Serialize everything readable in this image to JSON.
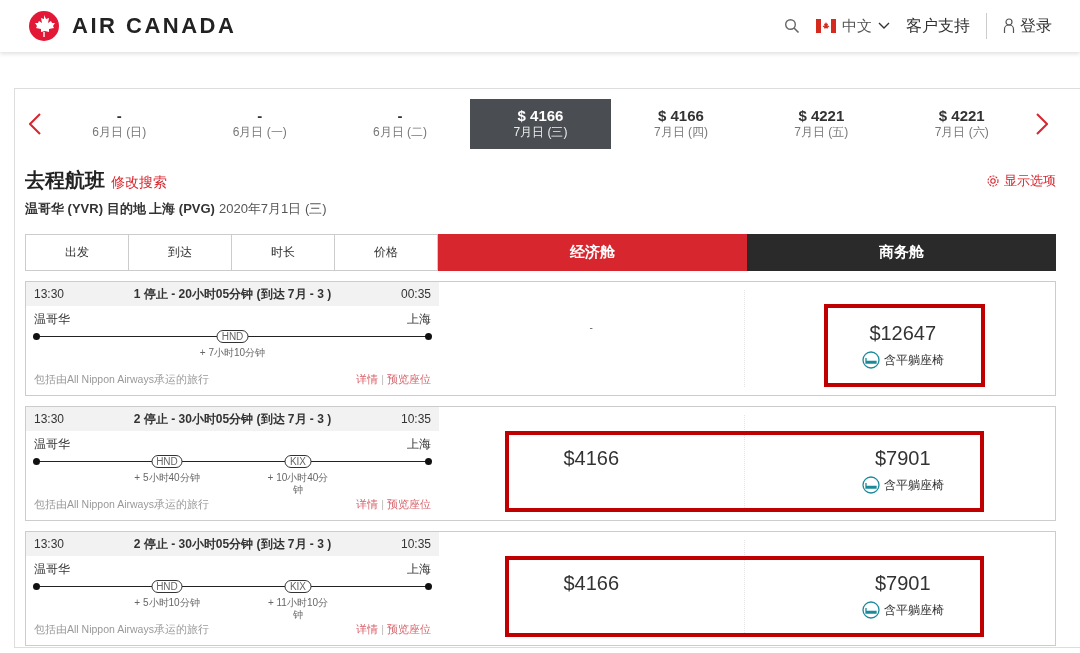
{
  "header": {
    "brand": "AIR CANADA",
    "language": "中文",
    "support": "客户支持",
    "login": "登录"
  },
  "dates": [
    {
      "price": "-",
      "date": "6月日 (日)",
      "selected": false
    },
    {
      "price": "-",
      "date": "6月日 (一)",
      "selected": false
    },
    {
      "price": "-",
      "date": "6月日 (二)",
      "selected": false
    },
    {
      "price": "$ 4166",
      "date": "7月日 (三)",
      "selected": true
    },
    {
      "price": "$ 4166",
      "date": "7月日 (四)",
      "selected": false
    },
    {
      "price": "$ 4221",
      "date": "7月日 (五)",
      "selected": false
    },
    {
      "price": "$ 4221",
      "date": "7月日 (六)",
      "selected": false
    }
  ],
  "heading": {
    "title": "去程航班",
    "modify": "修改搜索",
    "options": "显示选项",
    "route": "温哥华 (YVR) 目的地 上海 (PVG)",
    "date": "2020年7月1日 (三)"
  },
  "sort_columns": [
    "出发",
    "到达",
    "时长",
    "价格"
  ],
  "cabins": [
    {
      "label": "经济舱",
      "kind": "economy"
    },
    {
      "label": "商务舱",
      "kind": "business"
    }
  ],
  "flights": [
    {
      "depart": "13:30",
      "summary": "1 停止 - 20小时05分钟 (到达 7月 - 3 )",
      "arrive": "00:35",
      "origin": "温哥华",
      "destination": "上海",
      "stops": [
        {
          "code": "HND",
          "layover": "+ 7小时10分钟"
        }
      ],
      "operator": "包括由All Nippon Airways承运的旅行",
      "details": "详情",
      "separator": "|",
      "seats": "预览座位",
      "fares": [
        {
          "price": "-"
        },
        {
          "price": "$12647",
          "note": "含平躺座椅",
          "highlighted": true
        }
      ]
    },
    {
      "depart": "13:30",
      "summary": "2 停止 - 30小时05分钟 (到达 7月 - 3 )",
      "arrive": "10:35",
      "origin": "温哥华",
      "destination": "上海",
      "stops": [
        {
          "code": "HND",
          "layover": "+ 5小时40分钟"
        },
        {
          "code": "KIX",
          "layover": "+ 10小时40分钟"
        }
      ],
      "operator": "包括由All Nippon Airways承运的旅行",
      "details": "详情",
      "separator": "|",
      "seats": "预览座位",
      "fares": [
        {
          "price": "$4166",
          "highlighted": true
        },
        {
          "price": "$7901",
          "note": "含平躺座椅",
          "highlighted": true
        }
      ]
    },
    {
      "depart": "13:30",
      "summary": "2 停止 - 30小时05分钟 (到达 7月 - 3 )",
      "arrive": "10:35",
      "origin": "温哥华",
      "destination": "上海",
      "stops": [
        {
          "code": "HND",
          "layover": "+ 5小时10分钟"
        },
        {
          "code": "KIX",
          "layover": "+ 11小时10分钟"
        }
      ],
      "operator": "包括由All Nippon Airways承运的旅行",
      "details": "详情",
      "separator": "|",
      "seats": "预览座位",
      "fares": [
        {
          "price": "$4166",
          "highlighted": true
        },
        {
          "price": "$7901",
          "note": "含平躺座椅",
          "highlighted": true
        }
      ]
    }
  ]
}
